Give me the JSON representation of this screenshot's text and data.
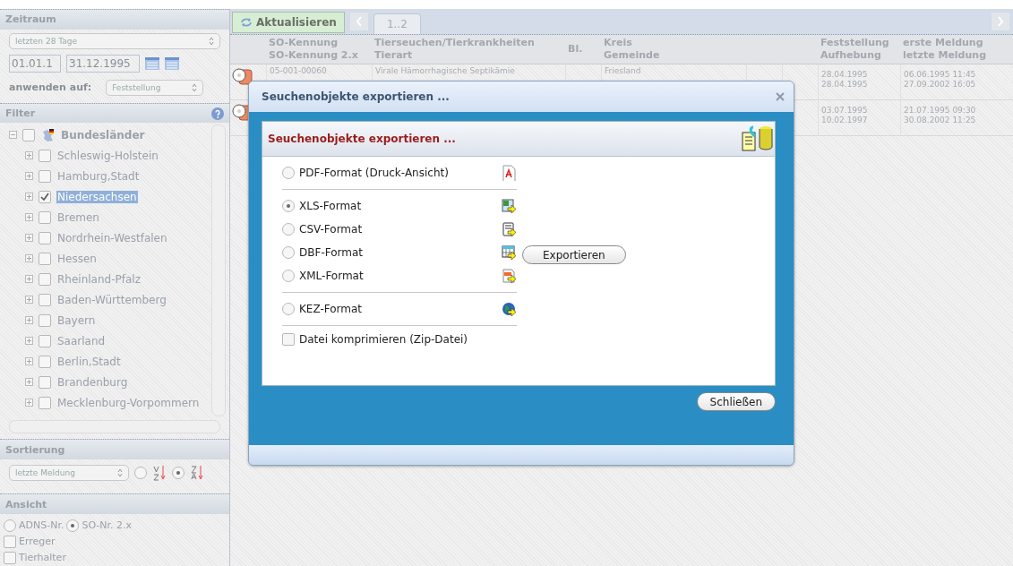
{
  "sidebar": {
    "zeitraum": {
      "title": "Zeitraum",
      "range_select": "letzten 28 Tage",
      "date_from": "01.01.1",
      "date_to": "31.12.1995",
      "apply_label": "anwenden auf:",
      "apply_select": "Feststellung"
    },
    "filter": {
      "title": "Filter",
      "tree": {
        "label": "Bundesländer",
        "checked": false,
        "expanded": true,
        "children": [
          {
            "label": "Schleswig-Holstein",
            "checked": false,
            "selected": false
          },
          {
            "label": "Hamburg,Stadt",
            "checked": false,
            "selected": false
          },
          {
            "label": "Niedersachsen",
            "checked": true,
            "selected": true
          },
          {
            "label": "Bremen",
            "checked": false,
            "selected": false
          },
          {
            "label": "Nordrhein-Westfalen",
            "checked": false,
            "selected": false
          },
          {
            "label": "Hessen",
            "checked": false,
            "selected": false
          },
          {
            "label": "Rheinland-Pfalz",
            "checked": false,
            "selected": false
          },
          {
            "label": "Baden-Württemberg",
            "checked": false,
            "selected": false
          },
          {
            "label": "Bayern",
            "checked": false,
            "selected": false
          },
          {
            "label": "Saarland",
            "checked": false,
            "selected": false
          },
          {
            "label": "Berlin,Stadt",
            "checked": false,
            "selected": false
          },
          {
            "label": "Brandenburg",
            "checked": false,
            "selected": false
          },
          {
            "label": "Mecklenburg-Vorpommern",
            "checked": false,
            "selected": false
          }
        ]
      }
    },
    "sortierung": {
      "title": "Sortierung",
      "select": "letzte Meldung",
      "options": [
        {
          "kind": "asc",
          "selected": false
        },
        {
          "kind": "desc",
          "selected": true
        }
      ]
    },
    "ansicht": {
      "title": "Ansicht",
      "radios": [
        {
          "label": "ADNS-Nr.",
          "selected": false
        },
        {
          "label": "SO-Nr. 2.x",
          "selected": true
        }
      ],
      "checkboxes": [
        {
          "label": "Erreger",
          "checked": false
        },
        {
          "label": "Tierhalter",
          "checked": false
        }
      ]
    }
  },
  "toolbar": {
    "refresh_button": "Aktualisieren",
    "tabs": [
      {
        "label": "1..2",
        "selected": true
      }
    ]
  },
  "table": {
    "columns": [
      {
        "line1": "SO-Kennung",
        "line2": "SO-Kennung 2.x",
        "kind": "so"
      },
      {
        "line1": "Tierseuchen/Tierkrankheiten",
        "line2": "Tierart",
        "kind": "disease"
      },
      {
        "line1": "Bl.",
        "kind": "bl"
      },
      {
        "line1": "Kreis",
        "line2": "Gemeinde",
        "kind": "kreis"
      },
      {
        "kind": "blank"
      },
      {
        "kind": "blank"
      },
      {
        "line1": "Feststellung",
        "line2": "Aufhebung",
        "kind": "dates"
      },
      {
        "line1": "erste Meldung",
        "line2": "letzte Meldung",
        "kind": "meldung"
      }
    ],
    "rows": [
      {
        "so": "05-001-00060",
        "disease": "Virale Hämorrhagische Septikämie",
        "kreis": "Friesland",
        "feststellung": "28.04.1995",
        "aufhebung": "28.04.1995",
        "erste": "06.06.1995 11:45",
        "letzte": "27.09.2002 16:05"
      },
      {
        "feststellung": "03.07.1995",
        "aufhebung": "10.02.1997",
        "erste": "21.07.1995 09:30",
        "letzte": "30.08.2002 11:25"
      }
    ]
  },
  "dialog": {
    "title": "Seuchenobjekte exportieren ...",
    "panel_title": "Seuchenobjekte exportieren ...",
    "groups": [
      [
        {
          "label": "PDF-Format (Druck-Ansicht)",
          "selected": false,
          "kind": "pdf"
        }
      ],
      [
        {
          "label": "XLS-Format",
          "selected": true,
          "kind": "xls"
        },
        {
          "label": "CSV-Format",
          "selected": false,
          "kind": "csv"
        },
        {
          "label": "DBF-Format",
          "selected": false,
          "kind": "dbf"
        },
        {
          "label": "XML-Format",
          "selected": false,
          "kind": "xml"
        }
      ],
      [
        {
          "label": "KEZ-Format",
          "selected": false,
          "kind": "kez"
        }
      ]
    ],
    "compress": {
      "label": "Datei komprimieren (Zip-Datei)",
      "checked": false
    },
    "export_button": "Exportieren",
    "close_button": "Schließen"
  }
}
